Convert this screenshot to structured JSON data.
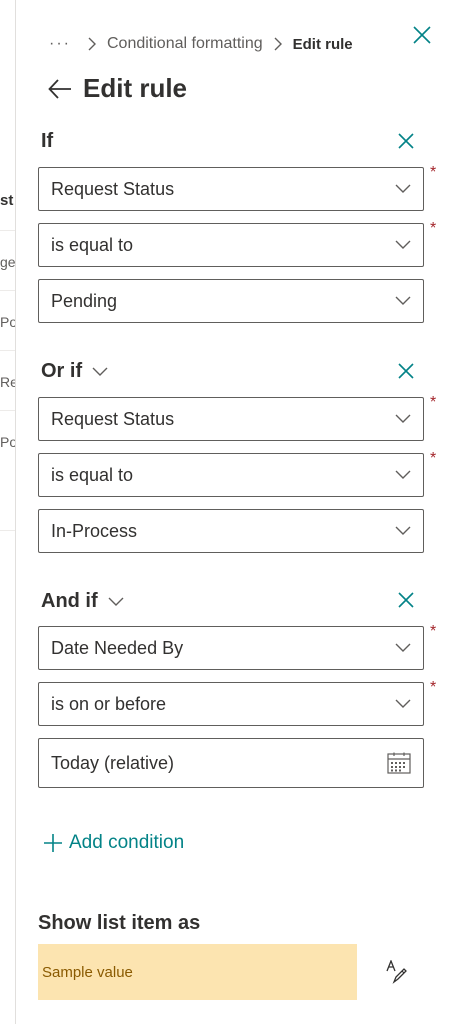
{
  "background_list": {
    "column_header": "st",
    "cells": [
      "ge",
      "Po",
      "Re",
      "Po"
    ]
  },
  "breadcrumb": {
    "more": "···",
    "parent": "Conditional formatting",
    "current": "Edit rule"
  },
  "page_title": "Edit rule",
  "condition_groups": [
    {
      "label": "If",
      "has_chevron": false,
      "column": "Request Status",
      "operator": "is equal to",
      "value": "Pending",
      "value_kind": "dropdown"
    },
    {
      "label": "Or if",
      "has_chevron": true,
      "column": "Request Status",
      "operator": "is equal to",
      "value": "In-Process",
      "value_kind": "dropdown"
    },
    {
      "label": "And if",
      "has_chevron": true,
      "column": "Date Needed By",
      "operator": "is on or before",
      "value": "Today (relative)",
      "value_kind": "date"
    }
  ],
  "required_marker": "*",
  "add_condition_label": "Add condition",
  "show_as": {
    "label": "Show list item as",
    "sample_text": "Sample value",
    "sample_background": "#fce4b0",
    "sample_text_color": "#8a5a00"
  },
  "colors": {
    "accent": "#038387",
    "required": "#a4262c",
    "border": "#605e5c"
  },
  "icons": {
    "close": "close-icon",
    "back": "back-arrow-icon",
    "chevron": "chevron-down-icon",
    "calendar": "calendar-icon",
    "add": "plus-icon",
    "format": "format-painter-icon"
  }
}
